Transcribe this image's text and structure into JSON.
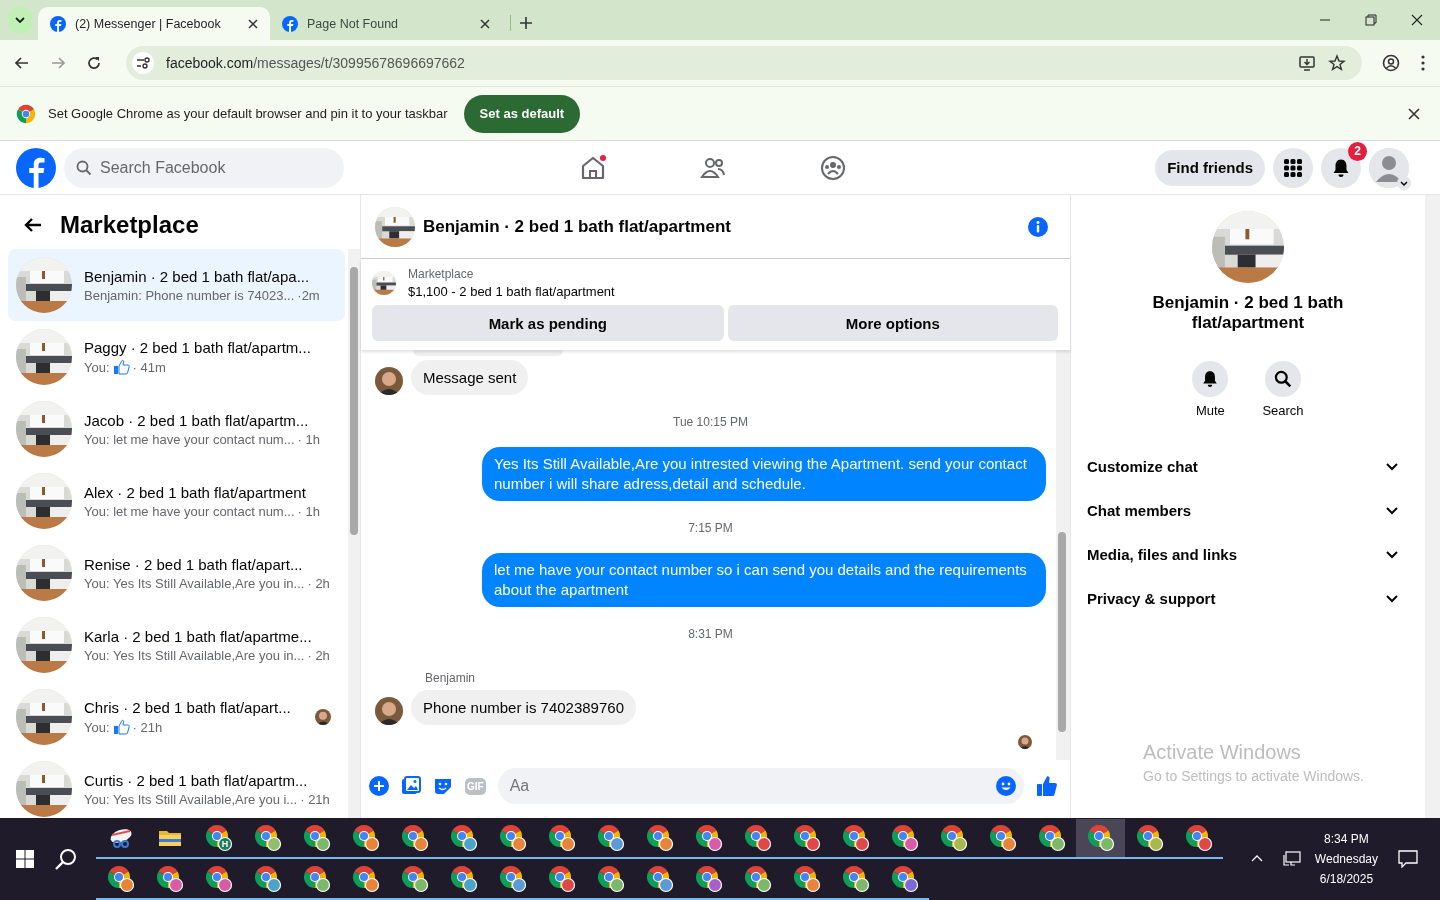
{
  "browser": {
    "tabs": [
      {
        "title": "(2) Messenger | Facebook",
        "selected": true
      },
      {
        "title": "Page Not Found",
        "selected": false
      }
    ],
    "url_host": "facebook.com",
    "url_path": "/messages/t/30995678696697662",
    "infobar": {
      "text": "Set Google Chrome as your default browser and pin it to your taskbar",
      "button": "Set as default"
    }
  },
  "header": {
    "search_placeholder": "Search Facebook",
    "find_friends": "Find friends",
    "notification_count": "2"
  },
  "sidebar": {
    "title": "Marketplace",
    "conversations": [
      {
        "title": "Benjamin · 2 bed 1 bath flat/apa...",
        "kind": "text",
        "preview": "Benjamin: Phone number is 74023...",
        "time": "·2m",
        "selected": true,
        "seen": false
      },
      {
        "title": "Paggy · 2 bed 1 bath flat/apartm...",
        "kind": "like",
        "preview": "You:",
        "time": "· 41m",
        "selected": false,
        "seen": false
      },
      {
        "title": "Jacob · 2 bed 1 bath flat/apartm...",
        "kind": "text",
        "preview": "You: let me have your contact num...",
        "time": "· 1h",
        "selected": false,
        "seen": false
      },
      {
        "title": "Alex · 2 bed 1 bath flat/apartment",
        "kind": "text",
        "preview": "You: let me have your contact num...",
        "time": "· 1h",
        "selected": false,
        "seen": false
      },
      {
        "title": "Renise · 2 bed 1 bath flat/apart...",
        "kind": "text",
        "preview": "You: Yes Its Still Available,Are you in...",
        "time": "· 2h",
        "selected": false,
        "seen": false
      },
      {
        "title": "Karla · 2 bed 1 bath flat/apartme...",
        "kind": "text",
        "preview": "You: Yes Its Still Available,Are you in...",
        "time": "· 2h",
        "selected": false,
        "seen": false
      },
      {
        "title": "Chris · 2 bed 1 bath flat/apart...",
        "kind": "like",
        "preview": "You:",
        "time": "· 21h",
        "selected": false,
        "seen": true
      },
      {
        "title": "Curtis · 2 bed 1 bath flat/apartm...",
        "kind": "text",
        "preview": "You: Yes Its Still Available,Are you i...",
        "time": "· 21h",
        "selected": false,
        "seen": false
      }
    ]
  },
  "chat": {
    "title": "Benjamin · 2 bed 1 bath flat/apartment",
    "listing": {
      "source": "Marketplace",
      "summary": "$1,100 - 2 bed 1 bath flat/apartment",
      "buttons": [
        "Mark as pending",
        "More options"
      ]
    },
    "messages": [
      {
        "kind": "incoming",
        "text": "Message sent"
      },
      {
        "kind": "time",
        "text": "Tue 10:15 PM"
      },
      {
        "kind": "outgoing",
        "text": "Yes Its Still Available,Are you intrested viewing the Apartment. send your contact number i will share adress,detail and schedule."
      },
      {
        "kind": "time",
        "text": "7:15 PM"
      },
      {
        "kind": "outgoing",
        "text": "let me have your contact number so i can send you details and the requirements about the apartment"
      },
      {
        "kind": "time",
        "text": "8:31 PM"
      },
      {
        "kind": "incoming",
        "sender": "Benjamin",
        "text": "Phone number is 7402389760"
      }
    ],
    "composer": {
      "placeholder": "Aa",
      "gif_label": "GIF"
    }
  },
  "details": {
    "title": "Benjamin · 2 bed 1 bath flat/apartment",
    "actions": [
      {
        "kind": "bell",
        "label": "Mute"
      },
      {
        "kind": "search",
        "label": "Search"
      }
    ],
    "sections": [
      {
        "label": "Customize chat",
        "expanded": false
      },
      {
        "label": "Chat members",
        "expanded": false
      },
      {
        "label": "Media, files and links",
        "expanded": false
      },
      {
        "label": "Privacy & support",
        "expanded": false
      }
    ]
  },
  "os_notice": {
    "title": "Activate Windows",
    "subtitle": "Go to Settings to activate Windows."
  },
  "taskbar": {
    "time": "8:34 PM",
    "day": "Wednesday",
    "date": "6/18/2025",
    "row_1": [
      {
        "kind": "snip",
        "selected": false
      },
      {
        "kind": "folder",
        "selected": false
      },
      {
        "kind": "browser",
        "color": "#1a7f5a",
        "badge": "H",
        "selected": false
      },
      {
        "kind": "browser",
        "color": "#8fbf6a",
        "selected": false
      },
      {
        "kind": "browser",
        "color": "#7cb86a",
        "selected": false
      },
      {
        "kind": "browser",
        "color": "#e8833a",
        "selected": false
      },
      {
        "kind": "browser",
        "color": "#e8833a",
        "selected": false
      },
      {
        "kind": "browser",
        "color": "#4aa3c8",
        "selected": false
      },
      {
        "kind": "browser",
        "color": "#e8833a",
        "selected": false
      },
      {
        "kind": "browser",
        "color": "#e8833a",
        "selected": false
      },
      {
        "kind": "browser",
        "color": "#5a9ad8",
        "selected": false
      },
      {
        "kind": "browser",
        "color": "#e8833a",
        "selected": false
      },
      {
        "kind": "browser",
        "color": "#d85aa8",
        "selected": false
      },
      {
        "kind": "browser",
        "color": "#e04848",
        "selected": false
      },
      {
        "kind": "browser",
        "color": "#e04848",
        "selected": false
      },
      {
        "kind": "browser",
        "color": "#e04848",
        "selected": false
      },
      {
        "kind": "browser",
        "color": "#d85aa8",
        "selected": false
      },
      {
        "kind": "browser",
        "color": "#a8b84a",
        "selected": false
      },
      {
        "kind": "browser",
        "color": "#e8833a",
        "selected": false
      },
      {
        "kind": "browser",
        "color": "#7cb86a",
        "selected": false
      },
      {
        "kind": "browser",
        "color": "#7cb86a",
        "selected": true
      },
      {
        "kind": "browser",
        "color": "#a8b84a",
        "selected": false
      },
      {
        "kind": "browser",
        "color": "#e04848",
        "selected": false
      }
    ],
    "row_2": [
      {
        "kind": "browser",
        "color": "#e8833a",
        "selected": false
      },
      {
        "kind": "browser",
        "color": "#d85aa8",
        "selected": false
      },
      {
        "kind": "browser",
        "color": "#d85aa8",
        "selected": false
      },
      {
        "kind": "browser",
        "color": "#4aa3c8",
        "selected": false
      },
      {
        "kind": "browser",
        "color": "#7cb86a",
        "selected": false
      },
      {
        "kind": "browser",
        "color": "#e8833a",
        "selected": false
      },
      {
        "kind": "browser",
        "color": "#7cb86a",
        "selected": false
      },
      {
        "kind": "browser",
        "color": "#4aa3c8",
        "selected": false
      },
      {
        "kind": "browser",
        "color": "#5a9ad8",
        "selected": false
      },
      {
        "kind": "browser",
        "color": "#e04848",
        "selected": false
      },
      {
        "kind": "browser",
        "color": "#7cb86a",
        "selected": false
      },
      {
        "kind": "browser",
        "color": "#5a9ad8",
        "selected": false
      },
      {
        "kind": "browser",
        "color": "#a860c8",
        "selected": false
      },
      {
        "kind": "browser",
        "color": "#7cb86a",
        "selected": false
      },
      {
        "kind": "browser",
        "color": "#e8833a",
        "selected": false
      },
      {
        "kind": "browser",
        "color": "#7cb86a",
        "selected": false
      },
      {
        "kind": "browser",
        "color": "#7a6ad8",
        "selected": false
      }
    ]
  }
}
